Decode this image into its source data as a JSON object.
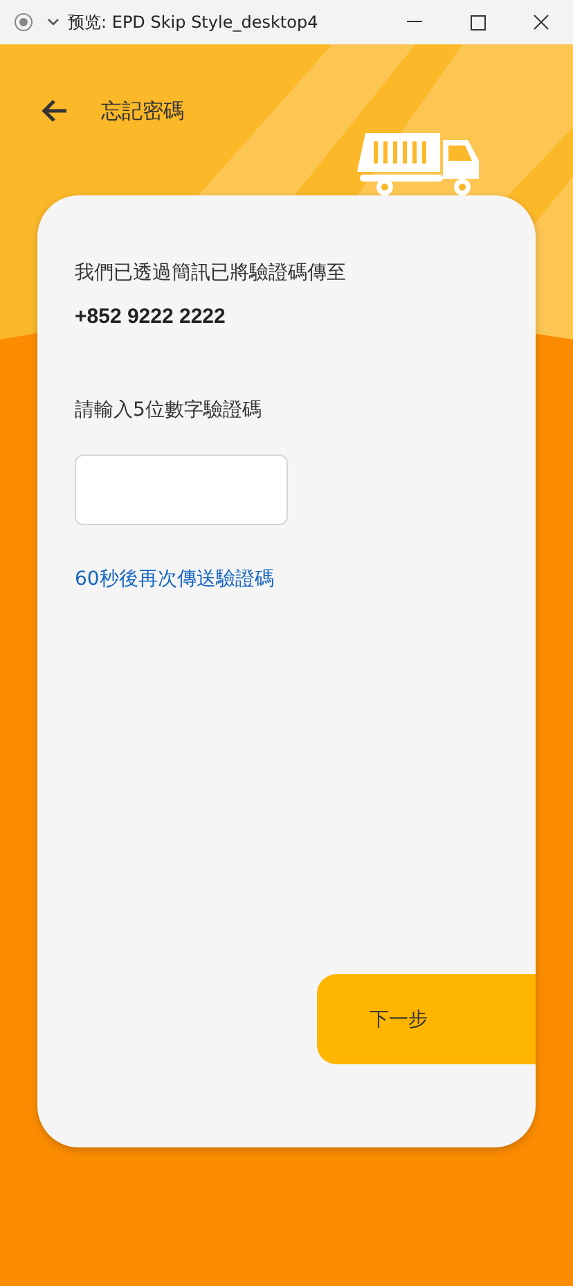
{
  "window": {
    "title": "预览: EPD Skip Style_desktop4"
  },
  "header": {
    "title": "忘記密碼"
  },
  "card": {
    "message": "我們已透過簡訊已將驗證碼傳至",
    "phone": "+852 9222 2222",
    "code_label": "請輸入5位數字驗證碼",
    "resend_link": "60秒後再次傳送驗證碼",
    "next_button": "下一步"
  }
}
